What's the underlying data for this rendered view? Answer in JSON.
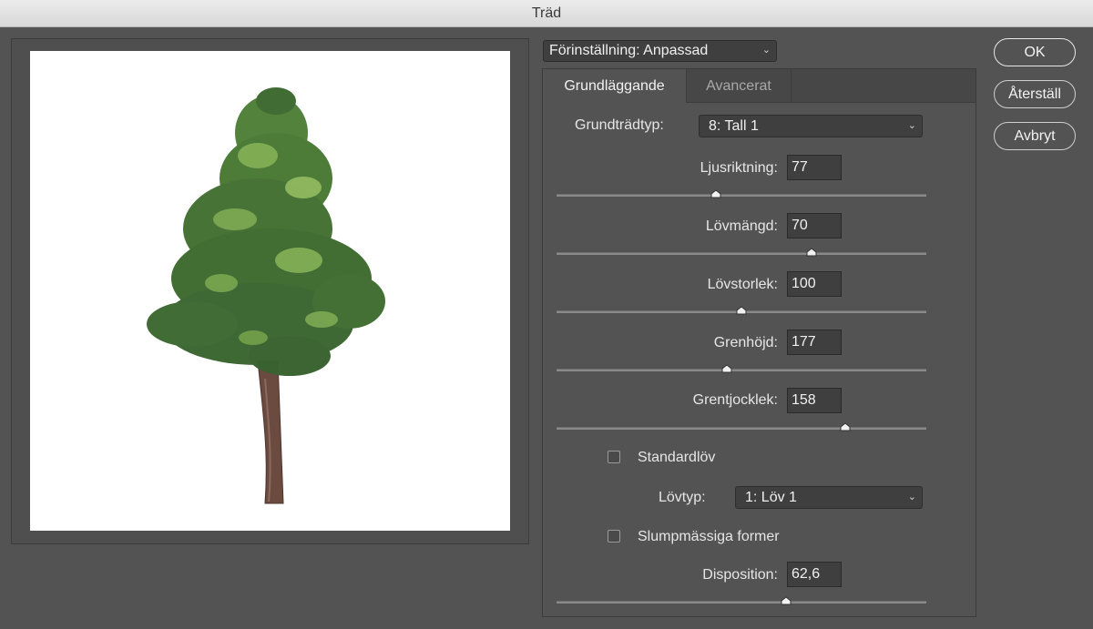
{
  "window": {
    "title": "Träd"
  },
  "preset": {
    "value": "Förinställning: Anpassad"
  },
  "tabs": [
    {
      "label": "Grundläggande",
      "active": true
    },
    {
      "label": "Avancerat",
      "active": false
    }
  ],
  "base_tree_type": {
    "label": "Grundträdtyp:",
    "value": "8: Tall 1"
  },
  "sliders": [
    {
      "label": "Ljusriktning:",
      "value": "77",
      "fraction": 0.43
    },
    {
      "label": "Lövmängd:",
      "value": "70",
      "fraction": 0.69
    },
    {
      "label": "Lövstorlek:",
      "value": "100",
      "fraction": 0.5
    },
    {
      "label": "Grenhöjd:",
      "value": "177",
      "fraction": 0.46
    },
    {
      "label": "Grentjocklek:",
      "value": "158",
      "fraction": 0.78
    }
  ],
  "default_leaves": {
    "label": "Standardlöv",
    "checked": false
  },
  "leaf_type": {
    "label": "Lövtyp:",
    "value": "1: Löv 1"
  },
  "random_shapes": {
    "label": "Slumpmässiga former",
    "checked": false
  },
  "disposition": {
    "label": "Disposition:",
    "value": "62,6",
    "fraction": 0.62
  },
  "buttons": {
    "ok": "OK",
    "reset": "Återställ",
    "cancel": "Avbryt"
  },
  "colors": {
    "background": "#535353",
    "foliage": "#4a7a3a",
    "trunk": "#6b4a40"
  }
}
